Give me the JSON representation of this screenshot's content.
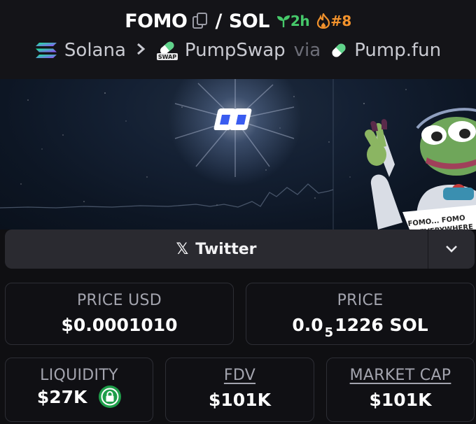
{
  "header": {
    "token_symbol": "FOMO",
    "separator": "/",
    "quote_symbol": "SOL",
    "age": "2h",
    "rank": "#8",
    "chain": "Solana",
    "dex": "PumpSwap",
    "dex_badge": "SWAP",
    "via": "via",
    "source": "Pump.fun"
  },
  "banner": {
    "sign_line1": "FOMO... FOMO",
    "sign_line2": "EVERYWHERE"
  },
  "links": {
    "twitter_label": "Twitter",
    "x_glyph": "𝕏"
  },
  "stats": {
    "price_usd_label": "PRICE USD",
    "price_usd_value": "$0.0001010",
    "price_label": "PRICE",
    "price_prefix": "0.0",
    "price_subscript": "5",
    "price_rest": "1226 SOL",
    "liquidity_label": "LIQUIDITY",
    "liquidity_value": "$27K",
    "fdv_label": "FDV",
    "fdv_value": "$101K",
    "mcap_label": "MARKET CAP",
    "mcap_value": "$101K"
  },
  "colors": {
    "age_green": "#46c96a",
    "rank_orange": "#f2922c",
    "lock_green": "#1f9e4a"
  }
}
